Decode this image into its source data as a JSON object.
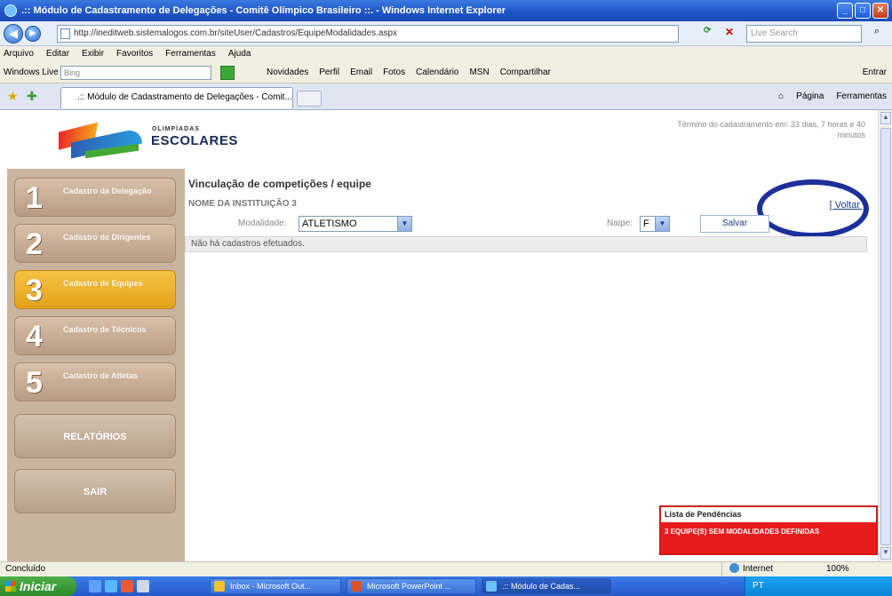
{
  "window": {
    "title": ".:: Módulo de Cadastramento de Delegações - Comitê Olímpico Brasileiro ::. - Windows Internet Explorer"
  },
  "address": {
    "url": "http://ineditweb.sistemalogos.com.br/siteUser/Cadastros/EquipeModalidades.aspx",
    "search_placeholder": "Live Search"
  },
  "menu": {
    "items": [
      "Arquivo",
      "Editar",
      "Exibir",
      "Favoritos",
      "Ferramentas",
      "Ajuda"
    ]
  },
  "links_bar": {
    "windows_live": "Windows Live",
    "search_placeholder": "Bing",
    "items": [
      "Novidades",
      "Perfil",
      "Email",
      "Fotos",
      "Calendário",
      "MSN",
      "Compartilhar"
    ],
    "entrar": "Entrar"
  },
  "tabs": {
    "active": ".:: Módulo de Cadastramento de Delegações - Comit...",
    "tools": [
      "Página",
      "Ferramentas"
    ]
  },
  "header": {
    "logo_top": "OLIMPÍADAS",
    "logo_bottom": "ESCOLARES",
    "termino": "Término do cadastramento em: 33 dias, 7 horas e 40 minutos"
  },
  "sidebar": {
    "items": [
      {
        "number": "1",
        "label": "Cadastro da Delegação"
      },
      {
        "number": "2",
        "label": "Cadastro de Dirigentes"
      },
      {
        "number": "3",
        "label": "Cadastro de Equipes"
      },
      {
        "number": "4",
        "label": "Cadastro de Técnicos"
      },
      {
        "number": "5",
        "label": "Cadastro de Atletas"
      }
    ],
    "relatorios": "RELATÓRIOS",
    "sair": "SAIR"
  },
  "main": {
    "title": "Vinculação de competições / equipe",
    "institution": "NOME DA INSTITUIÇÃO 3",
    "voltar": "[ Voltar ]",
    "modalidade_label": "Modalidade:",
    "modalidade_value": "ATLETISMO",
    "naipe_label": "Naipe:",
    "naipe_value": "F",
    "salvar": "Salvar",
    "empty_message": "Não há cadastros efetuados."
  },
  "pendencias": {
    "title": "Lista de Pendências",
    "item": "3 EQUIPE(S) SEM MODALIDADES DEFINIDAS"
  },
  "status": {
    "text": "Concluído",
    "zone": "Internet",
    "zoom": "100%"
  },
  "taskbar": {
    "start": "Iniciar",
    "buttons": [
      "Inbox - Microsoft Out...",
      "Microsoft PowerPoint ...",
      ".:: Módulo de Cadas..."
    ],
    "tray": "PT"
  },
  "colors": {
    "accent_blue": "#1c2f9a",
    "active_item": "#f2b52e",
    "sidebar_bg": "#c9b4a0",
    "pending_red": "#e81c1c"
  }
}
